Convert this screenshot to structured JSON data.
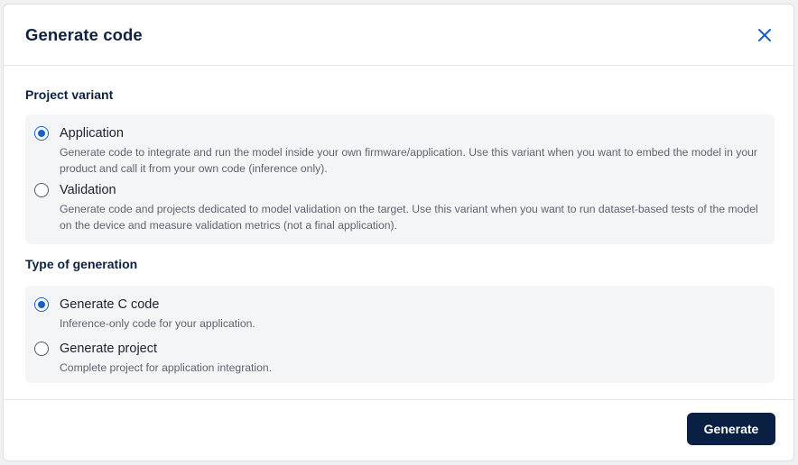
{
  "dialog": {
    "title": "Generate code",
    "close_icon": "close-icon"
  },
  "project_variant": {
    "title": "Project variant",
    "options": [
      {
        "label": "Application",
        "description": "Generate code to integrate and run the model inside your own firmware/application. Use this variant when you want to embed the model in your product and call it from your own code (inference only).",
        "selected": true
      },
      {
        "label": "Validation",
        "description": "Generate code and projects dedicated to model validation on the target. Use this variant when you want to run dataset-based tests of the model on the device and measure validation metrics (not a final application).",
        "selected": false
      }
    ]
  },
  "generation_type": {
    "title": "Type of generation",
    "options": [
      {
        "label": "Generate C code",
        "description": "Inference-only code for your application.",
        "selected": true
      },
      {
        "label": "Generate project",
        "description": "Complete project for application integration.",
        "selected": false
      }
    ]
  },
  "footer": {
    "generate_label": "Generate"
  },
  "colors": {
    "primary_dark": "#0a1f44",
    "radio_selected": "#1a5ec8",
    "panel_bg": "#f4f5f7"
  }
}
